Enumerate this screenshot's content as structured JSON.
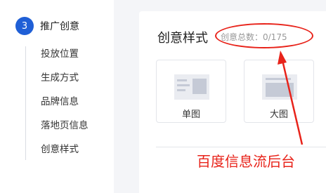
{
  "sidebar": {
    "step_number": "3",
    "step_title": "推广创意",
    "items": [
      {
        "label": "投放位置"
      },
      {
        "label": "生成方式"
      },
      {
        "label": "品牌信息"
      },
      {
        "label": "落地页信息"
      },
      {
        "label": "创意样式"
      }
    ]
  },
  "card": {
    "title": "创意样式",
    "count_label": "创意总数：0/175",
    "options": [
      {
        "label": "单图",
        "icon": "single-image-icon"
      },
      {
        "label": "大图",
        "icon": "large-image-icon"
      }
    ]
  },
  "annotation": {
    "caption": "百度信息流后台",
    "color": "#e8231a"
  },
  "colors": {
    "accent": "#1f5fd6",
    "background": "#f4f5f8"
  }
}
